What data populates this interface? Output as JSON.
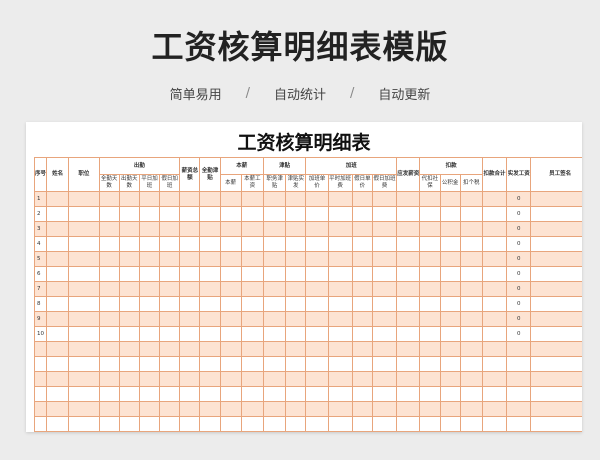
{
  "page": {
    "title": "工资核算明细表模版"
  },
  "features": [
    "简单易用",
    "自动统计",
    "自动更新"
  ],
  "separator": "/",
  "sheet": {
    "title": "工资核算明细表",
    "headers": {
      "seq": "序号",
      "name": "姓名",
      "position": "职位",
      "attendance": "出勤",
      "attendance_sub": [
        "全勤天数",
        "出勤天数",
        "平日加班",
        "假日加班"
      ],
      "salary_total": "薪资总额",
      "full_att_allowance": "全勤津贴",
      "base_salary": "本薪",
      "base_salary_sub": [
        "本薪",
        "本薪工资"
      ],
      "allowance": "津贴",
      "allowance_sub": [
        "职务津贴",
        "津贴实发"
      ],
      "overtime": "加班",
      "overtime_sub": [
        "加班单价",
        "平时加班费",
        "假日单价",
        "假日加班费"
      ],
      "payable": "应发薪资",
      "deductions": "扣款",
      "deductions_sub": [
        "代扣社保",
        "公积金",
        "扣个税"
      ],
      "deduction_total": "扣款合计",
      "net_pay": "实发工资",
      "signature": "员工签名"
    },
    "rows": [
      {
        "seq": "1",
        "net": "0"
      },
      {
        "seq": "2",
        "net": "0"
      },
      {
        "seq": "3",
        "net": "0"
      },
      {
        "seq": "4",
        "net": "0"
      },
      {
        "seq": "5",
        "net": "0"
      },
      {
        "seq": "6",
        "net": "0"
      },
      {
        "seq": "7",
        "net": "0"
      },
      {
        "seq": "8",
        "net": "0"
      },
      {
        "seq": "9",
        "net": "0"
      },
      {
        "seq": "10",
        "net": "0"
      },
      {
        "seq": "",
        "net": ""
      },
      {
        "seq": "",
        "net": ""
      },
      {
        "seq": "",
        "net": ""
      },
      {
        "seq": "",
        "net": ""
      },
      {
        "seq": "",
        "net": ""
      },
      {
        "seq": "",
        "net": ""
      }
    ],
    "colors": {
      "grid_border": "#e8a57c",
      "alt_row": "#fde3d2"
    }
  }
}
